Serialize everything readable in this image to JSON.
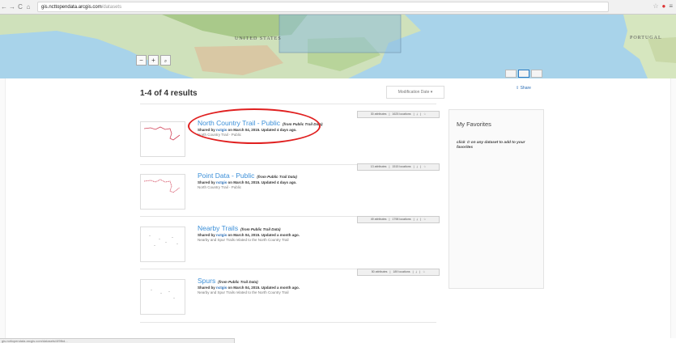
{
  "browser": {
    "url_host": "gis.ncttopendata.arcgis.com",
    "url_path": "/datasets"
  },
  "map": {
    "country_label": "UNITED STATES",
    "portugal_label": "PORTUGAL",
    "zoom_in": "+",
    "zoom_out": "−",
    "search_icon": "🔍"
  },
  "results": {
    "count_label": "1-4 of 4 results",
    "sort_label": "Modification Date ▾",
    "share_label": "Share"
  },
  "datasets": [
    {
      "title": "North Country Trail - Public",
      "source": "(from Public Trail Data)",
      "shared_prefix": "Shared by ",
      "user": "nctgis",
      "shared_suffix": " on March 04, 2015. Updated 4 days ago.",
      "description": "North Country Trail - Public",
      "attributes": "30 attributes",
      "locations": "1625 locations",
      "highlighted": true
    },
    {
      "title": "Point Data - Public",
      "source": "(from Public Trail Data)",
      "shared_prefix": "Shared by ",
      "user": "nctgis",
      "shared_suffix": " on March 04, 2015. Updated 4 days ago.",
      "description": "North Country Trail - Public",
      "attributes": "13 attributes",
      "locations": "1515 locations",
      "highlighted": false
    },
    {
      "title": "Nearby Trails",
      "source": "(from Public Trail Data)",
      "shared_prefix": "Shared by ",
      "user": "nctgis",
      "shared_suffix": " on March 04, 2015. Updated a month ago.",
      "description": "Nearby and Spur Trails related to the North Country Trail",
      "attributes": "49 attributes",
      "locations": "1798 locations",
      "highlighted": false
    },
    {
      "title": "Spurs",
      "source": "(from Public Trail Data)",
      "shared_prefix": "Shared by ",
      "user": "nctgis",
      "shared_suffix": " on March 04, 2015. Updated a month ago.",
      "description": "Nearby and Spur Trails related to the North Country Trail",
      "attributes": "50 attributes",
      "locations": "189 locations",
      "highlighted": false
    }
  ],
  "favorites": {
    "title": "My Favorites",
    "hint": "click ☆ on any dataset to add to your favorites"
  },
  "status_bar": {
    "text": "gis.ncttopendata.arcgis.com/datasets/4f9fbd..."
  },
  "colors": {
    "link": "#3b8fd8",
    "highlight": "#e02020",
    "trail": "#d2445a"
  }
}
